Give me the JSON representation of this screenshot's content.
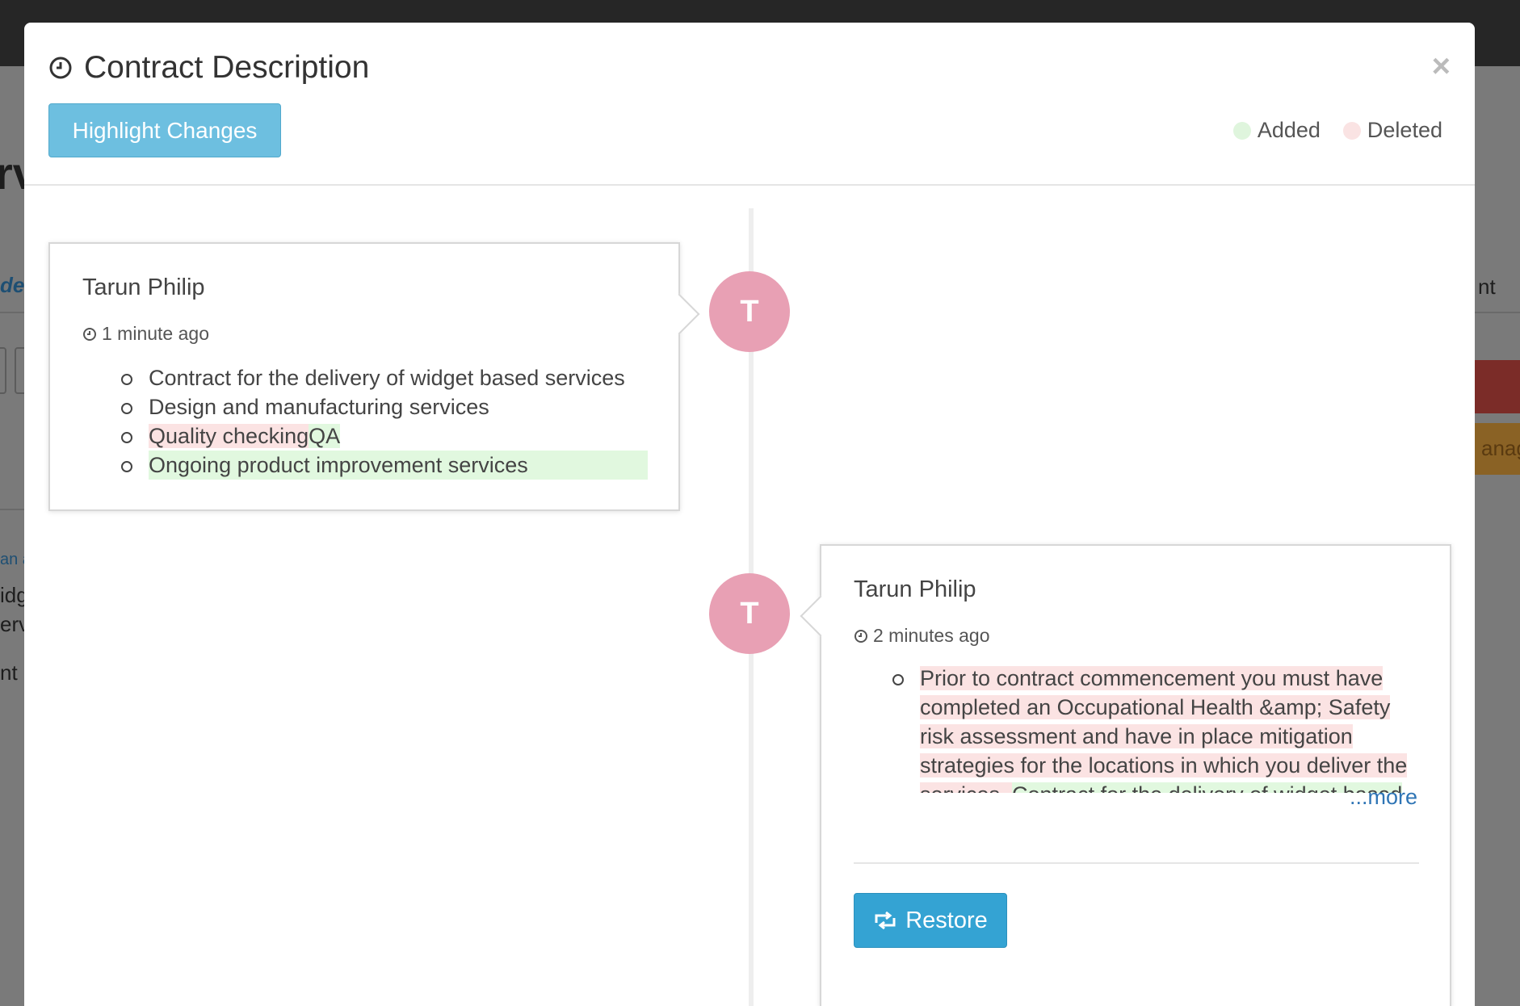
{
  "background": {
    "fragments": [
      "rv",
      "de",
      "nt",
      "an a",
      "idg",
      "erv",
      "nt",
      "anag"
    ]
  },
  "modal": {
    "title": "Contract Description",
    "close_label": "×",
    "highlight_button": "Highlight Changes",
    "legend": {
      "added": "Added",
      "deleted": "Deleted"
    },
    "colors": {
      "added": "#dff5dd",
      "deleted": "#fae3e3",
      "avatar": "#e8a0b4",
      "highlight_button": "#6dbfe0",
      "restore_button": "#34a3d3",
      "link": "#2f75b5"
    }
  },
  "entries": [
    {
      "avatar": "T",
      "author": "Tarun Philip",
      "time": "1 minute ago",
      "items": [
        {
          "text": "Contract for the delivery of widget based services"
        },
        {
          "text": "Design and manufacturing services"
        },
        {
          "deleted": "Quality checking",
          "added": "QA"
        },
        {
          "added": "Ongoing product improvement services"
        }
      ]
    },
    {
      "avatar": "T",
      "author": "Tarun Philip",
      "time": "2 minutes ago",
      "lines": [
        {
          "deleted": " Prior to contract commencement you must have"
        },
        {
          "deleted": "completed an Occupational Health &amp; Safety"
        },
        {
          "deleted": "risk assessment and have in place mitigation"
        },
        {
          "deleted": "strategies for the locations in which you deliver the"
        },
        {
          "deleted": "services. ",
          "added": " Contract for the delivery of widget based"
        }
      ],
      "more_label": "...more",
      "restore_label": "Restore"
    }
  ]
}
